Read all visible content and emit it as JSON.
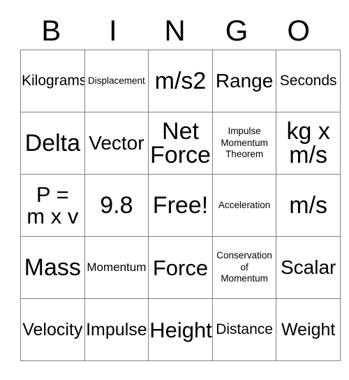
{
  "card": {
    "title_letters": [
      "B",
      "I",
      "N",
      "G",
      "O"
    ],
    "grid": [
      [
        {
          "text": "Kilograms",
          "size": "m"
        },
        {
          "text": "Displacement",
          "size": "xs"
        },
        {
          "text": "m/s2",
          "size": "3xl"
        },
        {
          "text": "Range",
          "size": "xl"
        },
        {
          "text": "Seconds",
          "size": "m"
        }
      ],
      [
        {
          "text": "Delta",
          "size": "3xl"
        },
        {
          "text": "Vector",
          "size": "xl"
        },
        {
          "text": "Net\nForce",
          "size": "3xl"
        },
        {
          "text": "Impulse\nMomentum\nTheorem",
          "size": "xs"
        },
        {
          "text": "kg x\nm/s",
          "size": "3xl"
        }
      ],
      [
        {
          "text": "P =\nm x v",
          "size": "2xl"
        },
        {
          "text": "9.8",
          "size": "3xl"
        },
        {
          "text": "Free!",
          "size": "3xl"
        },
        {
          "text": "Acceleration",
          "size": "xs"
        },
        {
          "text": "m/s",
          "size": "3xl"
        }
      ],
      [
        {
          "text": "Mass",
          "size": "3xl"
        },
        {
          "text": "Momentum",
          "size": "s"
        },
        {
          "text": "Force",
          "size": "2xl"
        },
        {
          "text": "Conservation\nof\nMomentum",
          "size": "xs"
        },
        {
          "text": "Scalar",
          "size": "xl"
        }
      ],
      [
        {
          "text": "Velocity",
          "size": "l"
        },
        {
          "text": "Impulse",
          "size": "l"
        },
        {
          "text": "Height",
          "size": "2xl"
        },
        {
          "text": "Distance",
          "size": "m"
        },
        {
          "text": "Weight",
          "size": "l"
        }
      ]
    ],
    "free_space": {
      "row": 2,
      "col": 2,
      "label": "Free!"
    },
    "colors": {
      "background": "#ffffff",
      "text": "#000000",
      "gridline": "#808080"
    }
  }
}
